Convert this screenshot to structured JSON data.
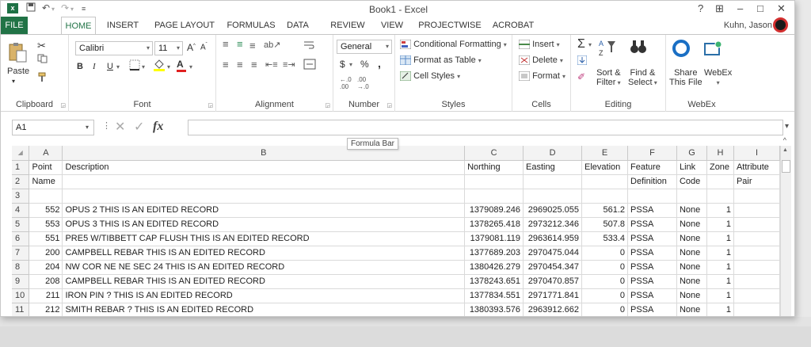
{
  "title": "Book1 - Excel",
  "quick_access": {
    "save_icon": "save-icon",
    "undo": "↶",
    "redo": "↷"
  },
  "window": {
    "help": "?",
    "restore_ribbon": "⊞",
    "minimize": "–",
    "maximize": "□",
    "close": "✕"
  },
  "tabs": [
    "FILE",
    "HOME",
    "INSERT",
    "PAGE LAYOUT",
    "FORMULAS",
    "DATA",
    "REVIEW",
    "VIEW",
    "PROJECTWISE",
    "ACROBAT"
  ],
  "user": "Kuhn, Jason",
  "ribbon": {
    "clipboard": {
      "label": "Clipboard",
      "paste": "Paste"
    },
    "font": {
      "label": "Font",
      "name": "Calibri",
      "size": "11",
      "bold": "B",
      "italic": "I",
      "underline": "U"
    },
    "alignment": {
      "label": "Alignment"
    },
    "number": {
      "label": "Number",
      "format": "General",
      "currency": "$",
      "percent": "%",
      "comma": ","
    },
    "styles": {
      "label": "Styles",
      "conditional": "Conditional Formatting",
      "format_table": "Format as Table",
      "cell_styles": "Cell Styles"
    },
    "cells": {
      "label": "Cells",
      "insert": "Insert",
      "delete": "Delete",
      "format": "Format"
    },
    "editing": {
      "label": "Editing",
      "sort_1": "Sort &",
      "sort_2": "Filter",
      "find_1": "Find &",
      "find_2": "Select"
    },
    "webex": {
      "label": "WebEx",
      "share_1": "Share",
      "share_2": "This File",
      "webex_btn": "WebEx"
    }
  },
  "formula_bar": {
    "name_box": "A1",
    "fx": "fx",
    "tooltip": "Formula Bar",
    "value": ""
  },
  "columns": [
    "A",
    "B",
    "C",
    "D",
    "E",
    "F",
    "G",
    "H",
    "I"
  ],
  "rows": [
    {
      "n": "1",
      "cells": [
        "Point",
        "Description",
        "Northing",
        "Easting",
        "Elevation",
        "Feature",
        "Link",
        "Zone",
        "Attribute"
      ]
    },
    {
      "n": "2",
      "cells": [
        "Name",
        "",
        "",
        "",
        "",
        "Definition",
        "Code",
        "",
        "Pair"
      ]
    },
    {
      "n": "3",
      "cells": [
        "",
        "",
        "",
        "",
        "",
        "",
        "",
        "",
        ""
      ]
    },
    {
      "n": "4",
      "cells": [
        "552",
        "OPUS 2 THIS IS AN EDITED RECORD",
        "1379089.246",
        "2969025.055",
        "561.2",
        "PSSA",
        "None",
        "1",
        ""
      ]
    },
    {
      "n": "5",
      "cells": [
        "553",
        "OPUS 3 THIS IS AN EDITED RECORD",
        "1378265.418",
        "2973212.346",
        "507.8",
        "PSSA",
        "None",
        "1",
        ""
      ]
    },
    {
      "n": "6",
      "cells": [
        "551",
        "PRE5 W/TIBBETT CAP FLUSH THIS IS AN EDITED RECORD",
        "1379081.119",
        "2963614.959",
        "533.4",
        "PSSA",
        "None",
        "1",
        ""
      ]
    },
    {
      "n": "7",
      "cells": [
        "200",
        "CAMPBELL REBAR THIS IS AN EDITED RECORD",
        "1377689.203",
        "2970475.044",
        "0",
        "PSSA",
        "None",
        "1",
        ""
      ]
    },
    {
      "n": "8",
      "cells": [
        "204",
        "NW COR NE NE SEC 24 THIS IS AN EDITED RECORD",
        "1380426.279",
        "2970454.347",
        "0",
        "PSSA",
        "None",
        "1",
        ""
      ]
    },
    {
      "n": "9",
      "cells": [
        "208",
        "CAMPBELL REBAR THIS IS AN EDITED RECORD",
        "1378243.651",
        "2970470.857",
        "0",
        "PSSA",
        "None",
        "1",
        ""
      ]
    },
    {
      "n": "10",
      "cells": [
        "211",
        "IRON PIN ? THIS IS AN EDITED RECORD",
        "1377834.551",
        "2971771.841",
        "0",
        "PSSA",
        "None",
        "1",
        ""
      ]
    },
    {
      "n": "11",
      "cells": [
        "212",
        "SMITH REBAR ? THIS IS AN EDITED RECORD",
        "1380393.576",
        "2963912.662",
        "0",
        "PSSA",
        "None",
        "1",
        ""
      ]
    }
  ]
}
